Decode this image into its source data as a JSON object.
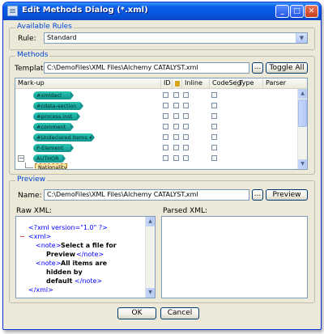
{
  "window": {
    "title": "Edit Methods Dialog (*.xml)",
    "minimize": "_",
    "maximize": "□",
    "close": "✕"
  },
  "available_rules": {
    "group_label": "Available Rules",
    "rule_label": "Rule:",
    "rule_value": "Standard"
  },
  "methods": {
    "group_label": "Methods",
    "template_label": "Template:",
    "template_value": "C:\\DemoFiles\\XML Files\\Alchemy CATALYST.xml",
    "browse": "...",
    "toggle_all": "Toggle All",
    "columns": {
      "markup": "Mark-up",
      "id": "ID",
      "inline": "Inline",
      "codeseg": "CodeSeg",
      "type": "Type",
      "parser": "Parser"
    },
    "rows": [
      {
        "label": "#xmldecl"
      },
      {
        "label": "#cdata-section"
      },
      {
        "label": "#process.inst"
      },
      {
        "label": "#comment"
      },
      {
        "label": "#Undeclared Items #"
      },
      {
        "label": "P-Element"
      },
      {
        "label": "AUTHOR"
      },
      {
        "label": "Nationality"
      }
    ],
    "tree_minus": "−"
  },
  "preview": {
    "group_label": "Preview",
    "name_label": "Name:",
    "name_value": "C:\\DemoFiles\\XML Files\\Alchemy CATALYST.xml",
    "browse": "...",
    "preview_button": "Preview",
    "raw_label": "Raw XML:",
    "parsed_label": "Parsed XML:",
    "xml": {
      "decl": "<?xml version=\"1.0\" ?>",
      "collapse": "−",
      "xml_open": "<xml>",
      "note_open": "<note>",
      "note_close": "</note>",
      "xml_close": "</xml>",
      "text1_a": "Select a file for",
      "text1_b": "Preview",
      "text2_a": "All items are",
      "text2_b": "hidden by",
      "text2_c": "default"
    }
  },
  "buttons": {
    "ok": "OK",
    "cancel": "Cancel"
  }
}
